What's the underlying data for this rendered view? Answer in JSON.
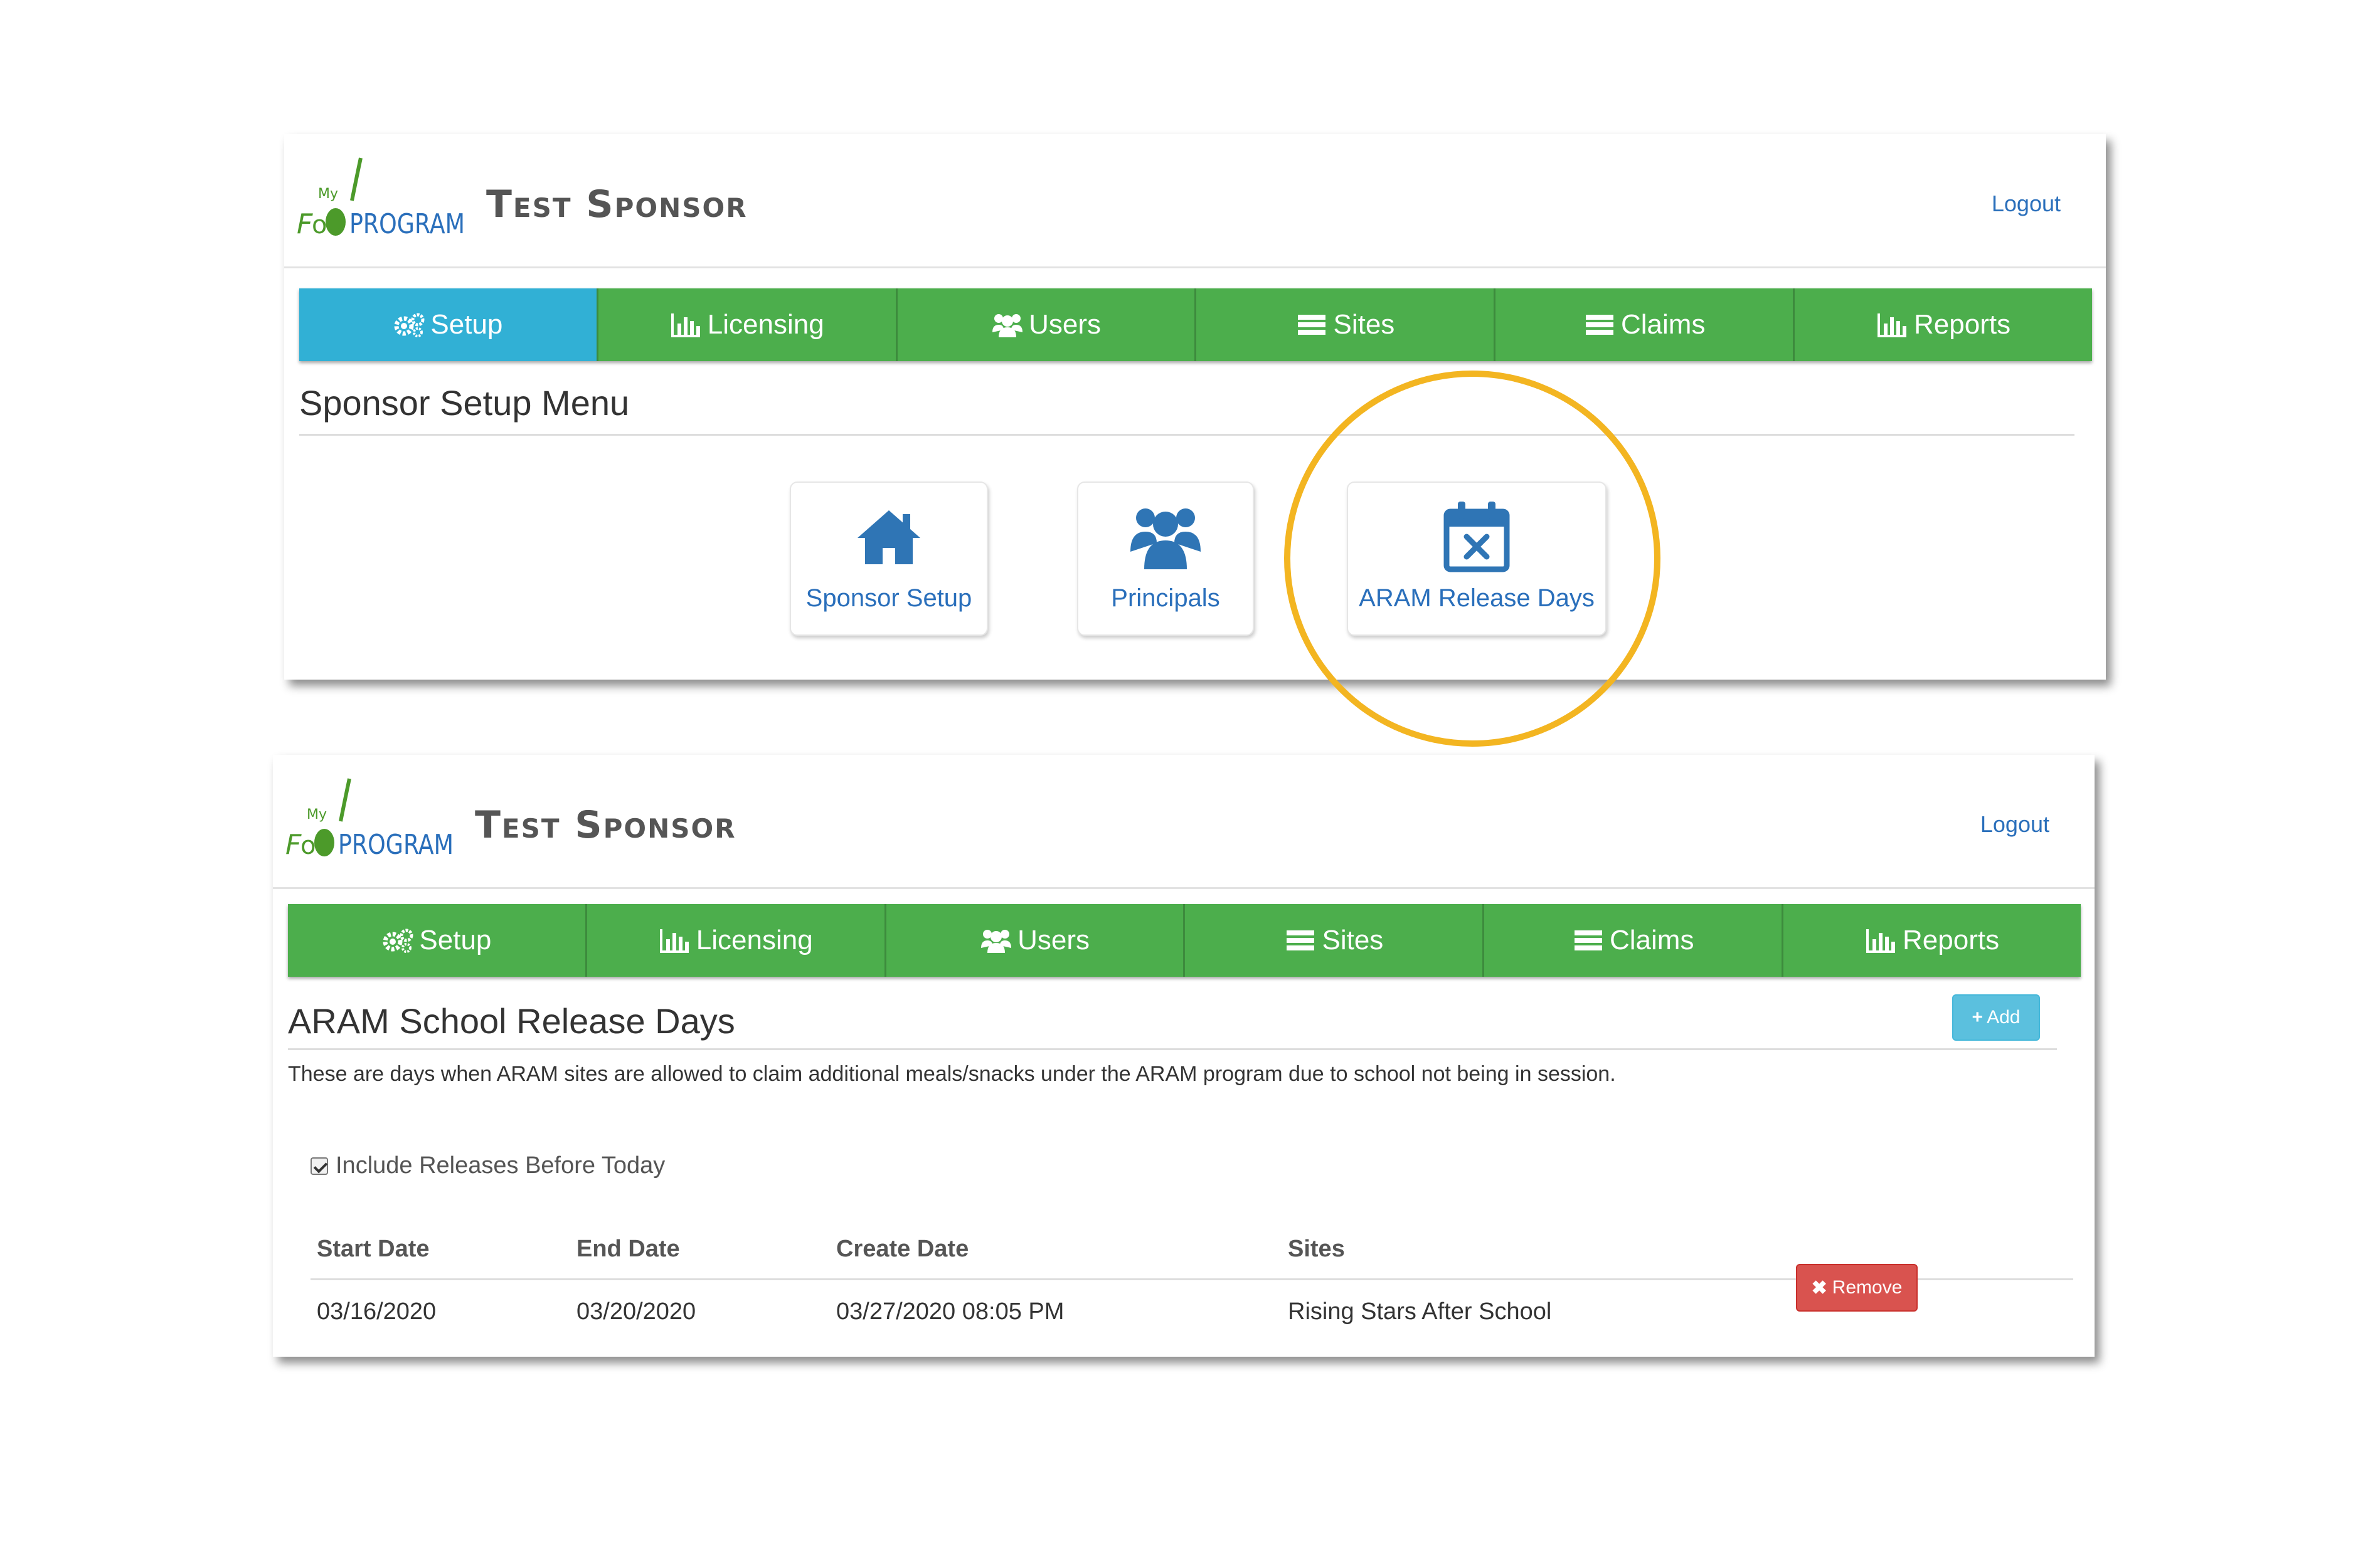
{
  "app": {
    "logo_text": "My Food Program",
    "sponsor_name": "Test Sponsor",
    "logout_label": "Logout"
  },
  "nav": [
    {
      "label": "Setup",
      "icon": "gears-icon"
    },
    {
      "label": "Licensing",
      "icon": "bar-chart-icon"
    },
    {
      "label": "Users",
      "icon": "users-icon"
    },
    {
      "label": "Sites",
      "icon": "list-icon"
    },
    {
      "label": "Claims",
      "icon": "list-icon"
    },
    {
      "label": "Reports",
      "icon": "bar-chart-icon"
    }
  ],
  "top_panel": {
    "active_nav": "Setup",
    "title": "Sponsor Setup Menu",
    "tiles": [
      {
        "label": "Sponsor Setup",
        "icon": "home-icon"
      },
      {
        "label": "Principals",
        "icon": "users-icon"
      },
      {
        "label": "ARAM Release Days",
        "icon": "calendar-x-icon"
      }
    ],
    "highlight_color": "#f3b521"
  },
  "bottom_panel": {
    "title": "ARAM School Release Days",
    "add_label": "Add",
    "description": "These are days when ARAM sites are allowed to claim additional meals/snacks under the ARAM program due to school not being in session.",
    "checkbox_label": "Include Releases Before Today",
    "checkbox_checked": true,
    "table": {
      "headers": [
        "Start Date",
        "End Date",
        "Create Date",
        "Sites"
      ],
      "rows": [
        {
          "start_date": "03/16/2020",
          "end_date": "03/20/2020",
          "create_date": "03/27/2020 08:05 PM",
          "sites": "Rising Stars After School",
          "action": "Remove"
        }
      ]
    }
  },
  "colors": {
    "nav_green": "#4cae4c",
    "nav_active": "#31b0d5",
    "link_blue": "#2a6fbb",
    "add_button": "#5bc0de",
    "remove_button": "#d9534f"
  }
}
